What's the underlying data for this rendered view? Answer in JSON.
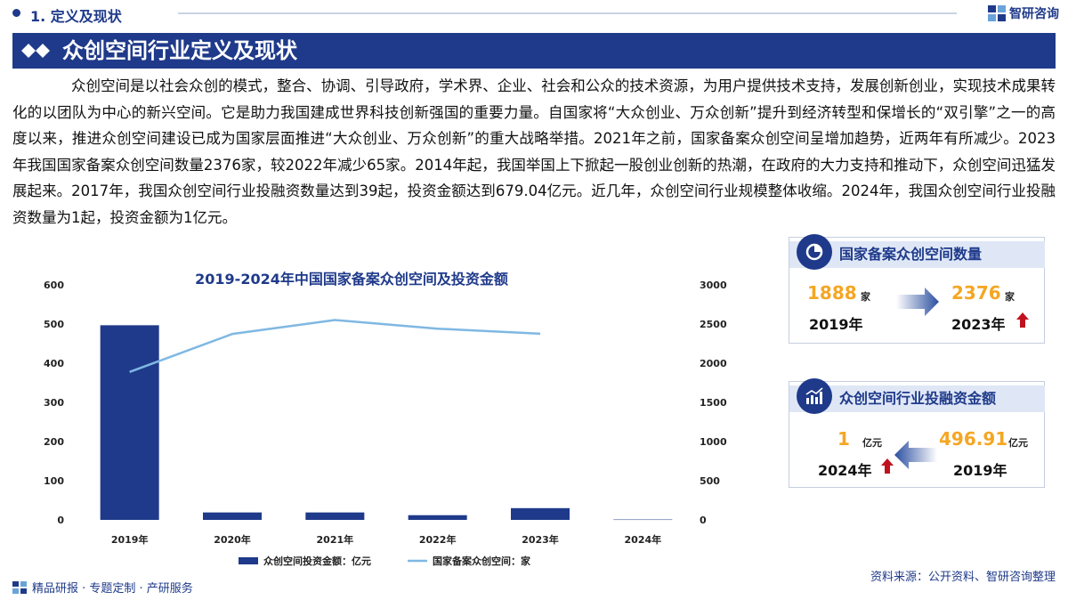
{
  "header": {
    "section_title": "1. 定义及现状",
    "brand_name": "智研咨询"
  },
  "banner": {
    "title": "众创空间行业定义及现状"
  },
  "intro_text": "众创空间是以社会众创的模式，整合、协调、引导政府，学术界、企业、社会和公众的技术资源，为用户提供技术支持，发展创新创业，实现技术成果转化的以团队为中心的新兴空间。它是助力我国建成世界科技创新强国的重要力量。自国家将“大众创业、万众创新”提升到经济转型和保增长的“双引擎”之一的高度以来，推进众创空间建设已成为国家层面推进“大众创业、万众创新”的重大战略举措。2021年之前，国家备案众创空间呈增加趋势，近两年有所减少。2023年我国国家备案众创空间数量2376家，较2022年减少65家。2014年起，我国举国上下掀起一股创业创新的热潮，在政府的大力支持和推动下，众创空间迅猛发展起来。2017年，我国众创空间行业投融资数量达到39起，投资金额达到679.04亿元。近几年，众创空间行业规模整体收缩。2024年，我国众创空间行业投融资数量为1起，投资金额为1亿元。",
  "chart_data": {
    "type": "bar",
    "title": "2019-2024年中国国家备案众创空间及投资金额",
    "categories": [
      "2019年",
      "2020年",
      "2021年",
      "2022年",
      "2023年",
      "2024年"
    ],
    "series": [
      {
        "name": "众创空间投资金额：亿元",
        "type": "bar",
        "axis": "left",
        "values": [
          496.91,
          19,
          19,
          12,
          30,
          1
        ],
        "color": "#1f3a8a"
      },
      {
        "name": "国家备案众创空间：家",
        "type": "line",
        "axis": "right",
        "values": [
          1888,
          2373,
          2551,
          2441,
          2376,
          null
        ],
        "color": "#7fb8e3"
      }
    ],
    "y_left": {
      "min": 0,
      "max": 600,
      "ticks": [
        "0",
        "100",
        "200",
        "300",
        "400",
        "500",
        "600"
      ]
    },
    "y_right": {
      "min": 0,
      "max": 3000,
      "ticks": [
        "0",
        "500",
        "1000",
        "1500",
        "2000",
        "2500",
        "3000"
      ]
    },
    "legend_position": "bottom",
    "grid": false
  },
  "card_count": {
    "title": "国家备案众创空间数量",
    "icon": "pie-chart-icon",
    "from_value": "1888",
    "from_unit": "家",
    "from_year": "2019年",
    "to_value": "2376",
    "to_unit": "家",
    "to_year": "2023年",
    "trend": "up",
    "trend_color": "#c0121e"
  },
  "card_funding": {
    "title": "众创空间行业投融资金额",
    "icon": "bar-trend-icon",
    "left_value": "1",
    "left_unit": "亿元",
    "left_year": "2024年",
    "right_value": "496.91",
    "right_unit": "亿元",
    "right_year": "2019年",
    "trend": "up",
    "trend_color": "#c0121e"
  },
  "footer": {
    "left_text": "精品研报 · 专题定制 · 产研服务",
    "source": "资料来源：公开资料、智研咨询整理"
  },
  "colors": {
    "primary": "#1f3a8a",
    "accent": "#f5a623",
    "line": "#7fb8e3",
    "trend_up": "#c0121e"
  }
}
